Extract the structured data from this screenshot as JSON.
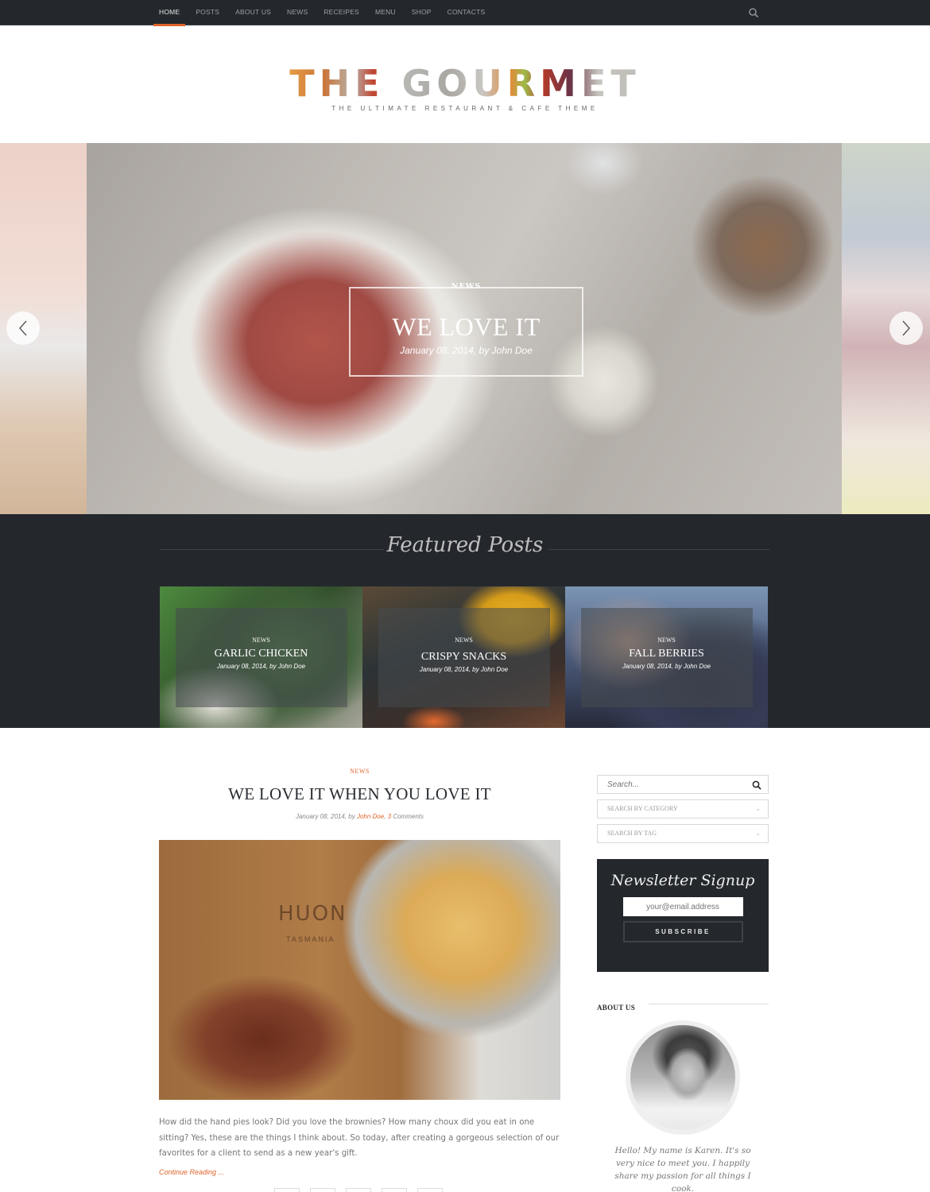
{
  "nav": {
    "items": [
      {
        "label": "HOME",
        "active": true
      },
      {
        "label": "POSTS",
        "active": false
      },
      {
        "label": "ABOUT US",
        "active": false
      },
      {
        "label": "NEWS",
        "active": false
      },
      {
        "label": "RECEIPES",
        "active": false
      },
      {
        "label": "MENU",
        "active": false
      },
      {
        "label": "SHOP",
        "active": false
      },
      {
        "label": "CONTACTS",
        "active": false
      }
    ],
    "search_icon": "search-icon"
  },
  "logo": {
    "title": "THE GOURMET",
    "subtitle": "THE ULTIMATE RESTAURANT & CAFE THEME"
  },
  "hero": {
    "category": "NEWS",
    "title": "WE LOVE IT",
    "meta": "January 08, 2014, by John Doe",
    "prev_icon": "chevron-left-icon",
    "next_icon": "chevron-right-icon"
  },
  "featured": {
    "heading": "Featured Posts",
    "cards": [
      {
        "category": "NEWS",
        "title": "GARLIC CHICKEN",
        "meta": "January 08, 2014, by John Doe"
      },
      {
        "category": "NEWS",
        "title": "CRISPY SNACKS",
        "meta": "January 08, 2014, by John Doe"
      },
      {
        "category": "NEWS",
        "title": "FALL BERRIES",
        "meta": "January 08, 2014, by John Doe"
      }
    ]
  },
  "post": {
    "category": "NEWS",
    "title": "WE LOVE IT WHEN YOU LOVE IT",
    "meta_date": "January 08, 2014, by ",
    "meta_author": "John Doe",
    "meta_sep": ", ",
    "meta_comments_count": "3",
    "meta_comments_label": " Comments",
    "image_brand": "HUON",
    "image_brand_sub": "TASMANIA",
    "excerpt": "How did the hand pies look?  Did you love the brownies?  How many choux did you eat in one sitting?  Yes, these are the things I think about.  So today, after creating a gorgeous selection of our favorites for a client to send as a new year's gift.",
    "continue_label": "Continue Reading ...",
    "accent_color": "#e0642b"
  },
  "sidebar": {
    "search_placeholder": "Search...",
    "category_select": "SEARCH BY CATEGORY",
    "tag_select": "SEARCH BY TAG",
    "newsletter": {
      "title": "Newsletter Signup",
      "email_placeholder": "your@email.address",
      "button": "SUBSCRIBE"
    },
    "about": {
      "heading": "ABOUT US",
      "text": "Hello! My name is Karen. It's so very nice to meet you. I happily share my passion for all things I cook."
    }
  }
}
